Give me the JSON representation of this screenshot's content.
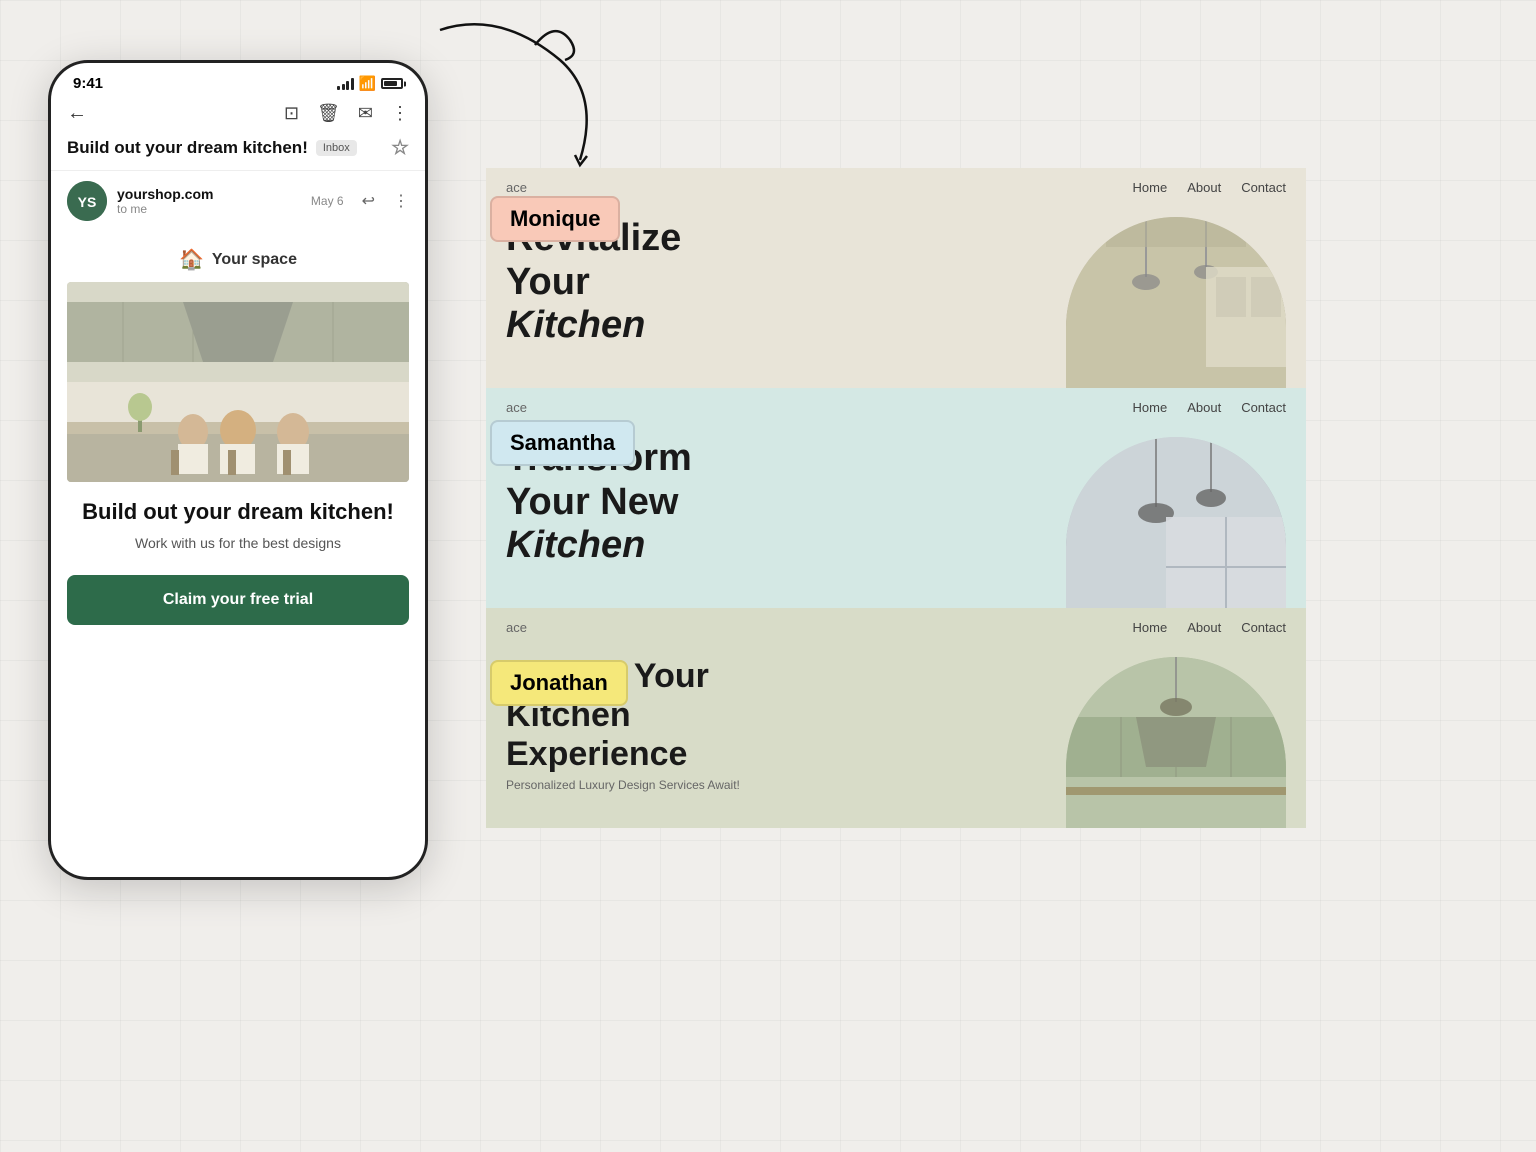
{
  "phone": {
    "status_time": "9:41",
    "email_subject": "Build out your dream kitchen!",
    "inbox_label": "Inbox",
    "sender_name": "yourshop.com",
    "sender_to": "to me",
    "date": "May 6",
    "logo_text": "Your space",
    "email_title": "Build out your dream kitchen!",
    "email_subtitle": "Work with us for the best designs",
    "cta_label": "Claim your free trial"
  },
  "badges": {
    "monique": "Monique",
    "samantha": "Samantha",
    "jonathan": "Jonathan"
  },
  "previews": [
    {
      "brand": "ace",
      "nav": [
        "Home",
        "About",
        "Contact"
      ],
      "headline": "Revitalize Your",
      "headline2": "Kitchen",
      "theme": "warm"
    },
    {
      "brand": "ace",
      "nav": [
        "Home",
        "About",
        "Contact"
      ],
      "headline": "Transform Your New",
      "headline2": "Kitchen",
      "theme": "light"
    },
    {
      "brand": "ace",
      "nav": [
        "Home",
        "About",
        "Contact"
      ],
      "headline": "Elevate Your Kitchen Experience",
      "subtext": "Personalized Luxury Design Services Await!",
      "theme": "sage"
    }
  ]
}
